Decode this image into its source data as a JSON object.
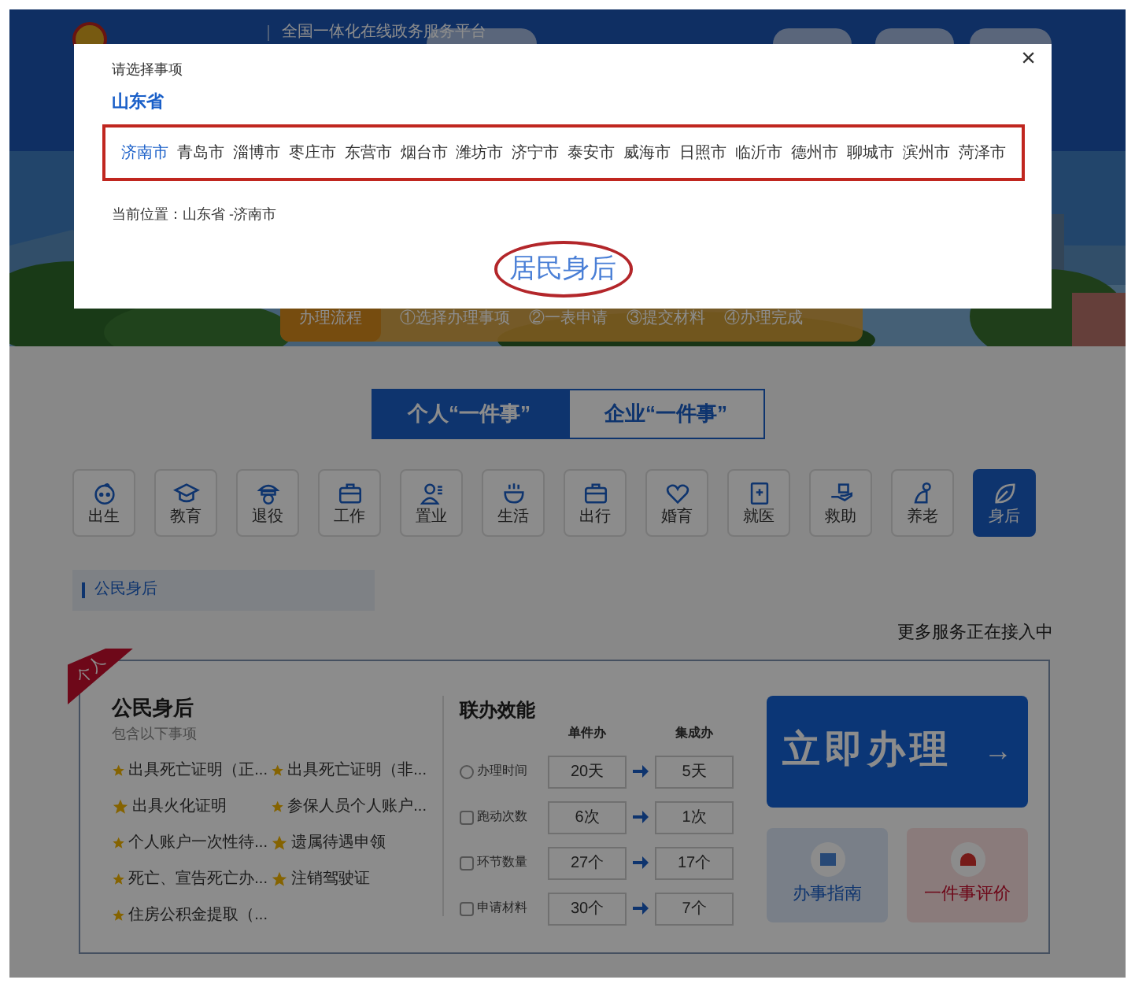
{
  "header": {
    "subtitle": "全国一体化在线政务服务平台"
  },
  "process_steps": [
    "办理流程",
    "①选择办理事项",
    "②一表申请",
    "③提交材料",
    "④办理完成"
  ],
  "tabs": [
    {
      "label": "个人“一件事”",
      "selected": true
    },
    {
      "label": "企业“一件事”",
      "selected": false
    }
  ],
  "categories": [
    {
      "label": "出生",
      "selected": false
    },
    {
      "label": "教育",
      "selected": false
    },
    {
      "label": "退役",
      "selected": false
    },
    {
      "label": "工作",
      "selected": false
    },
    {
      "label": "置业",
      "selected": false
    },
    {
      "label": "生活",
      "selected": false
    },
    {
      "label": "出行",
      "selected": false
    },
    {
      "label": "婚育",
      "selected": false
    },
    {
      "label": "就医",
      "selected": false
    },
    {
      "label": "救助",
      "selected": false
    },
    {
      "label": "养老",
      "selected": false
    },
    {
      "label": "身后",
      "selected": true
    }
  ],
  "section_title": "公民身后",
  "notice": "更多服务正在接入中",
  "card": {
    "ribbon": "个人",
    "title": "公民身后",
    "subtitle": "包含以下事项",
    "items": [
      "出具死亡证明（正...",
      "出具死亡证明（非...",
      "出具火化证明",
      "参保人员个人账户...",
      "个人账户一次性待...",
      "遗属待遇申领",
      "死亡、宣告死亡办...",
      "注销驾驶证",
      "住房公积金提取（..."
    ],
    "efficiency": {
      "title": "联办效能",
      "columns": [
        "单件办",
        "集成办"
      ],
      "rows": [
        {
          "label": "办理时间",
          "before": "20天",
          "after": "5天"
        },
        {
          "label": "跑动次数",
          "before": "6次",
          "after": "1次"
        },
        {
          "label": "环节数量",
          "before": "27个",
          "after": "17个"
        },
        {
          "label": "申请材料",
          "before": "30个",
          "after": "7个"
        }
      ]
    },
    "primary_button": {
      "label": "立即办理",
      "arrow": "→"
    },
    "links": [
      "办事指南",
      "一件事评价"
    ]
  },
  "modal": {
    "close": "×",
    "prompt": "请选择事项",
    "province": "山东省",
    "cities": [
      {
        "label": "济南市",
        "selected": true
      },
      {
        "label": "青岛市",
        "selected": false
      },
      {
        "label": "淄博市",
        "selected": false
      },
      {
        "label": "枣庄市",
        "selected": false
      },
      {
        "label": "东营市",
        "selected": false
      },
      {
        "label": "烟台市",
        "selected": false
      },
      {
        "label": "潍坊市",
        "selected": false
      },
      {
        "label": "济宁市",
        "selected": false
      },
      {
        "label": "泰安市",
        "selected": false
      },
      {
        "label": "威海市",
        "selected": false
      },
      {
        "label": "日照市",
        "selected": false
      },
      {
        "label": "临沂市",
        "selected": false
      },
      {
        "label": "德州市",
        "selected": false
      },
      {
        "label": "聊城市",
        "selected": false
      },
      {
        "label": "滨州市",
        "selected": false
      },
      {
        "label": "菏泽市",
        "selected": false
      }
    ],
    "location": "当前位置：山东省 -济南市",
    "highlight": "居民身后"
  }
}
